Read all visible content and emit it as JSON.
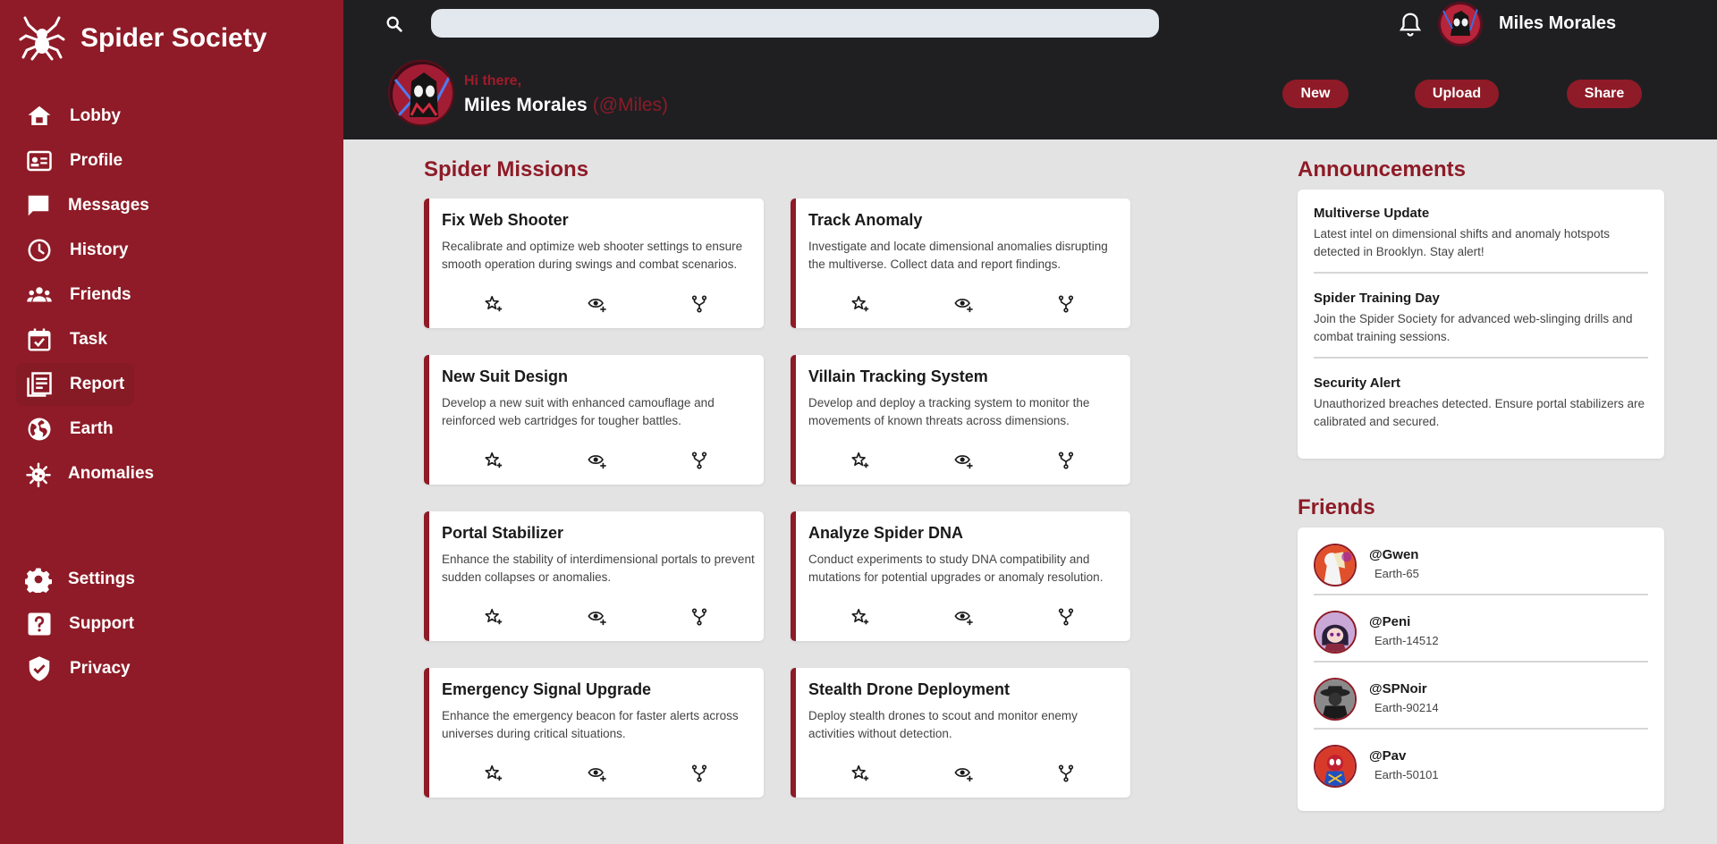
{
  "app": {
    "name": "Spider Society"
  },
  "colors": {
    "brand": "#8e1b27",
    "topbar": "#1f1f22",
    "background": "#e3e3e3"
  },
  "sidebar": {
    "items": [
      {
        "label": "Lobby",
        "icon": "home-icon"
      },
      {
        "label": "Profile",
        "icon": "id-card-icon"
      },
      {
        "label": "Messages",
        "icon": "chat-icon"
      },
      {
        "label": "History",
        "icon": "clock-icon"
      },
      {
        "label": "Friends",
        "icon": "group-icon"
      },
      {
        "label": "Task",
        "icon": "calendar-check-icon"
      },
      {
        "label": "Report",
        "icon": "newspaper-icon",
        "active": true
      },
      {
        "label": "Earth",
        "icon": "globe-icon"
      },
      {
        "label": "Anomalies",
        "icon": "coronavirus-icon"
      }
    ],
    "bottom_items": [
      {
        "label": "Settings",
        "icon": "gear-icon"
      },
      {
        "label": "Support",
        "icon": "help-icon"
      },
      {
        "label": "Privacy",
        "icon": "shield-check-icon"
      }
    ]
  },
  "topbar": {
    "search_placeholder": "",
    "username": "Miles Morales",
    "greeting": "Hi there,",
    "display_name": "Miles Morales",
    "handle": "(@Miles)",
    "buttons": {
      "new": "New",
      "upload": "Upload",
      "share": "Share"
    }
  },
  "missions": {
    "title": "Spider Missions",
    "cards": [
      {
        "title": "Fix Web Shooter",
        "desc": "Recalibrate and optimize web shooter settings to ensure smooth operation during swings and combat scenarios."
      },
      {
        "title": "Track Anomaly",
        "desc": "Investigate and locate dimensional anomalies disrupting the multiverse. Collect data and report findings."
      },
      {
        "title": "New Suit Design",
        "desc": "Develop a new suit with enhanced camouflage and reinforced web cartridges for tougher battles."
      },
      {
        "title": "Villain Tracking System",
        "desc": "Develop and deploy a tracking system to monitor the movements of known threats across dimensions."
      },
      {
        "title": "Portal Stabilizer",
        "desc": "Enhance the stability of interdimensional portals to prevent sudden collapses or anomalies."
      },
      {
        "title": "Analyze Spider DNA",
        "desc": "Conduct experiments to study DNA compatibility and mutations for potential upgrades or anomaly resolution."
      },
      {
        "title": "Emergency Signal Upgrade",
        "desc": "Enhance the emergency beacon for faster alerts across universes during critical situations."
      },
      {
        "title": "Stealth Drone Deployment",
        "desc": "Deploy stealth drones to scout and monitor enemy activities without detection."
      }
    ]
  },
  "announcements": {
    "title": "Announcements",
    "items": [
      {
        "title": "Multiverse Update",
        "body": "Latest intel on dimensional shifts and anomaly hotspots detected in Brooklyn. Stay alert!"
      },
      {
        "title": "Spider Training Day",
        "body": "Join the Spider Society for advanced web-slinging drills and combat training sessions."
      },
      {
        "title": "Security Alert",
        "body": "Unauthorized breaches detected. Ensure portal stabilizers are calibrated and secured."
      }
    ]
  },
  "friends": {
    "title": "Friends",
    "items": [
      {
        "handle": "@Gwen",
        "earth": "Earth-65"
      },
      {
        "handle": "@Peni",
        "earth": "Earth-14512"
      },
      {
        "handle": "@SPNoir",
        "earth": "Earth-90214"
      },
      {
        "handle": "@Pav",
        "earth": "Earth-50101"
      }
    ]
  }
}
